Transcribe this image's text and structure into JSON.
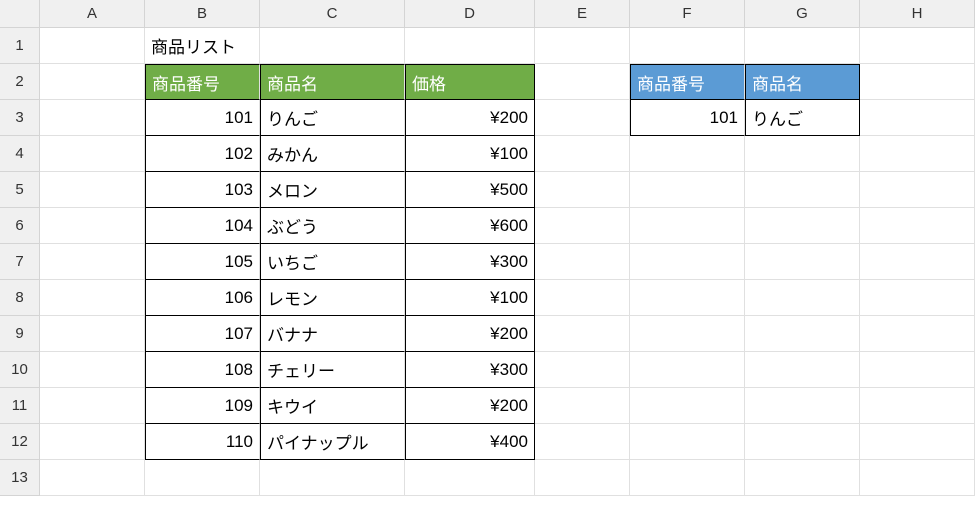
{
  "columns": [
    "A",
    "B",
    "C",
    "D",
    "E",
    "F",
    "G",
    "H"
  ],
  "rows": [
    "1",
    "2",
    "3",
    "4",
    "5",
    "6",
    "7",
    "8",
    "9",
    "10",
    "11",
    "12",
    "13"
  ],
  "title": "商品リスト",
  "table1": {
    "headers": {
      "id": "商品番号",
      "name": "商品名",
      "price": "価格"
    },
    "rows": [
      {
        "id": "101",
        "name": "りんご",
        "price": "¥200"
      },
      {
        "id": "102",
        "name": "みかん",
        "price": "¥100"
      },
      {
        "id": "103",
        "name": "メロン",
        "price": "¥500"
      },
      {
        "id": "104",
        "name": "ぶどう",
        "price": "¥600"
      },
      {
        "id": "105",
        "name": "いちご",
        "price": "¥300"
      },
      {
        "id": "106",
        "name": "レモン",
        "price": "¥100"
      },
      {
        "id": "107",
        "name": "バナナ",
        "price": "¥200"
      },
      {
        "id": "108",
        "name": "チェリー",
        "price": "¥300"
      },
      {
        "id": "109",
        "name": "キウイ",
        "price": "¥200"
      },
      {
        "id": "110",
        "name": "パイナップル",
        "price": "¥400"
      }
    ]
  },
  "table2": {
    "headers": {
      "id": "商品番号",
      "name": "商品名"
    },
    "row": {
      "id": "101",
      "name": "りんご"
    }
  }
}
